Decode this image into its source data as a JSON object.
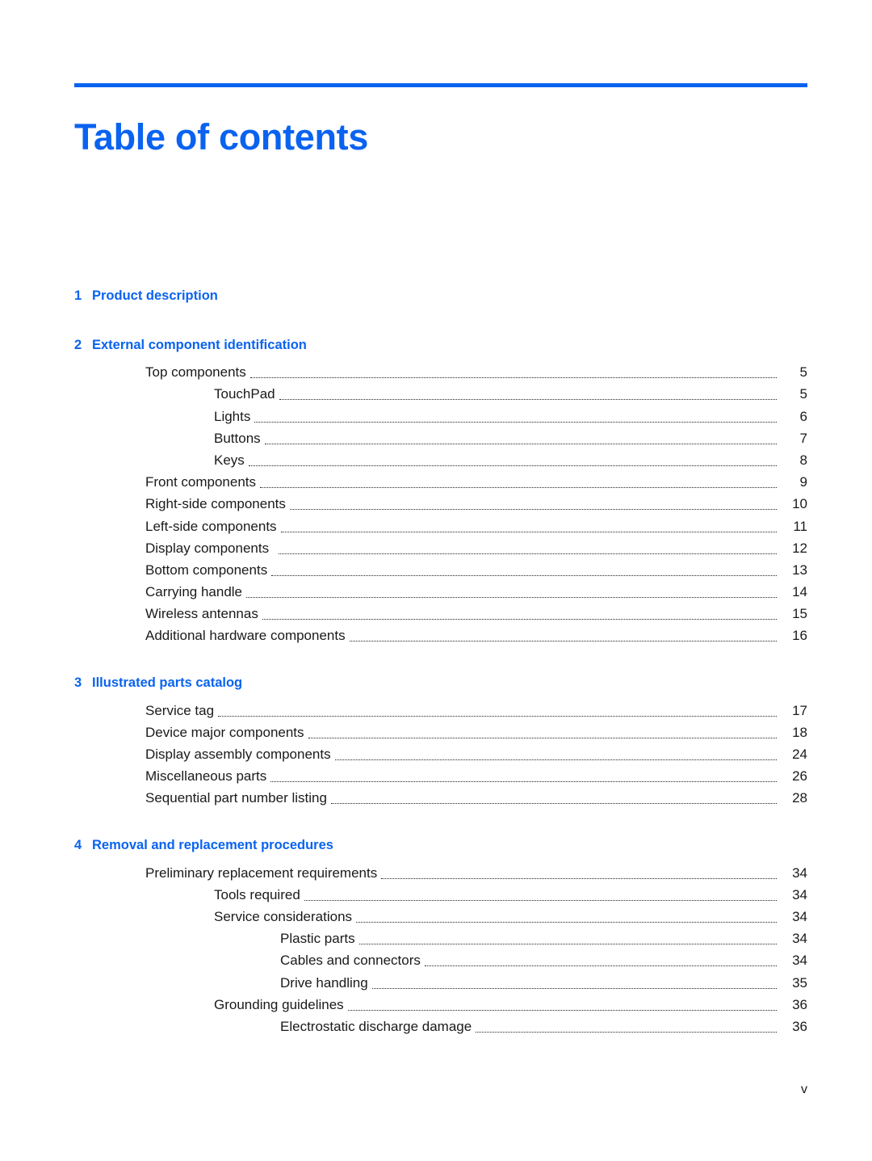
{
  "document": {
    "title": "Table of contents",
    "accent_color": "#0a63f0",
    "footer_page_label": "v"
  },
  "toc": {
    "chapters": [
      {
        "number": "1",
        "title": "Product description",
        "entries": []
      },
      {
        "number": "2",
        "title": "External component identification",
        "entries": [
          {
            "level": 1,
            "label": "Top components",
            "page": "5"
          },
          {
            "level": 2,
            "label": "TouchPad",
            "page": "5"
          },
          {
            "level": 2,
            "label": "Lights",
            "page": "6"
          },
          {
            "level": 2,
            "label": "Buttons",
            "page": "7"
          },
          {
            "level": 2,
            "label": "Keys",
            "page": "8"
          },
          {
            "level": 1,
            "label": "Front components",
            "page": "9"
          },
          {
            "level": 1,
            "label": "Right-side components",
            "page": "10"
          },
          {
            "level": 1,
            "label": "Left-side components",
            "page": "11"
          },
          {
            "level": 1,
            "label": "Display components",
            "page": "12",
            "trailing_space": true
          },
          {
            "level": 1,
            "label": "Bottom components",
            "page": "13"
          },
          {
            "level": 1,
            "label": "Carrying handle",
            "page": "14"
          },
          {
            "level": 1,
            "label": "Wireless antennas",
            "page": "15"
          },
          {
            "level": 1,
            "label": "Additional hardware components",
            "page": "16"
          }
        ]
      },
      {
        "number": "3",
        "title": "Illustrated parts catalog",
        "entries": [
          {
            "level": 1,
            "label": "Service tag",
            "page": "17"
          },
          {
            "level": 1,
            "label": "Device major components",
            "page": "18"
          },
          {
            "level": 1,
            "label": "Display assembly components",
            "page": "24"
          },
          {
            "level": 1,
            "label": "Miscellaneous parts",
            "page": "26"
          },
          {
            "level": 1,
            "label": "Sequential part number listing",
            "page": "28"
          }
        ]
      },
      {
        "number": "4",
        "title": "Removal and replacement procedures",
        "entries": [
          {
            "level": 1,
            "label": "Preliminary replacement requirements",
            "page": "34"
          },
          {
            "level": 2,
            "label": "Tools required",
            "page": "34"
          },
          {
            "level": 2,
            "label": "Service considerations",
            "page": "34"
          },
          {
            "level": 3,
            "label": "Plastic parts",
            "page": "34"
          },
          {
            "level": 3,
            "label": "Cables and connectors",
            "page": "34"
          },
          {
            "level": 3,
            "label": "Drive handling",
            "page": "35"
          },
          {
            "level": 2,
            "label": "Grounding guidelines",
            "page": "36"
          },
          {
            "level": 3,
            "label": "Electrostatic discharge damage",
            "page": "36"
          }
        ]
      }
    ]
  }
}
